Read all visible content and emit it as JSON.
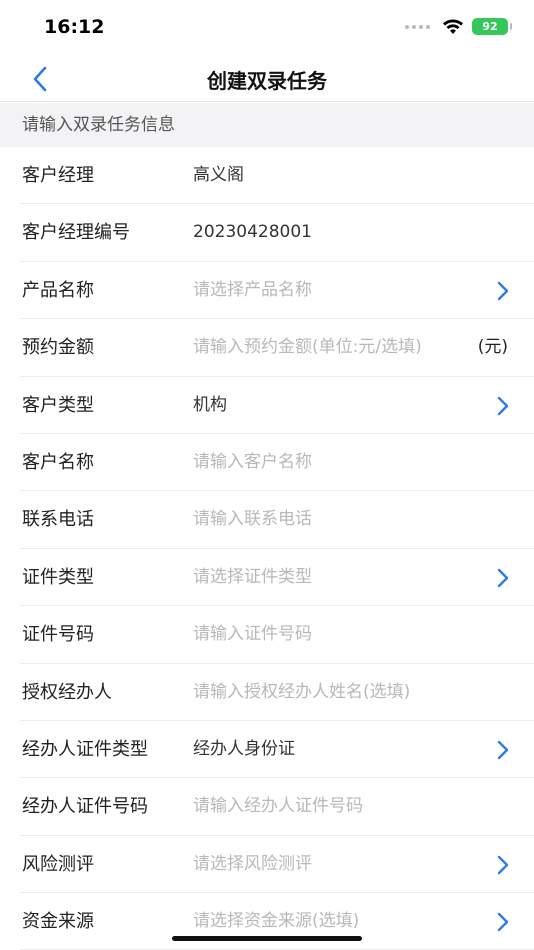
{
  "status": {
    "time": "16:12",
    "battery": "92"
  },
  "nav": {
    "title": "创建双录任务"
  },
  "section": {
    "header": "请输入双录任务信息"
  },
  "rows": [
    {
      "label": "客户经理",
      "value": "高义阁",
      "placeholder": false,
      "chevron": false
    },
    {
      "label": "客户经理编号",
      "value": "20230428001",
      "placeholder": false,
      "chevron": false
    },
    {
      "label": "产品名称",
      "value": "请选择产品名称",
      "placeholder": true,
      "chevron": true
    },
    {
      "label": "预约金额",
      "value": "请输入预约金额(单位:元/选填)",
      "placeholder": true,
      "chevron": false,
      "suffix": "(元)"
    },
    {
      "label": "客户类型",
      "value": "机构",
      "placeholder": false,
      "chevron": true
    },
    {
      "label": "客户名称",
      "value": "请输入客户名称",
      "placeholder": true,
      "chevron": false
    },
    {
      "label": "联系电话",
      "value": "请输入联系电话",
      "placeholder": true,
      "chevron": false
    },
    {
      "label": "证件类型",
      "value": "请选择证件类型",
      "placeholder": true,
      "chevron": true
    },
    {
      "label": "证件号码",
      "value": "请输入证件号码",
      "placeholder": true,
      "chevron": false
    },
    {
      "label": "授权经办人",
      "value": "请输入授权经办人姓名(选填)",
      "placeholder": true,
      "chevron": false
    },
    {
      "label": "经办人证件类型",
      "value": "经办人身份证",
      "placeholder": false,
      "chevron": true
    },
    {
      "label": "经办人证件号码",
      "value": "请输入经办人证件号码",
      "placeholder": true,
      "chevron": false
    },
    {
      "label": "风险测评",
      "value": "请选择风险测评",
      "placeholder": true,
      "chevron": true
    },
    {
      "label": "资金来源",
      "value": "请选择资金来源(选填)",
      "placeholder": true,
      "chevron": true
    }
  ],
  "colors": {
    "accent": "#2f7be0",
    "battery": "#34c759",
    "section_bg": "#f3f3f5"
  }
}
